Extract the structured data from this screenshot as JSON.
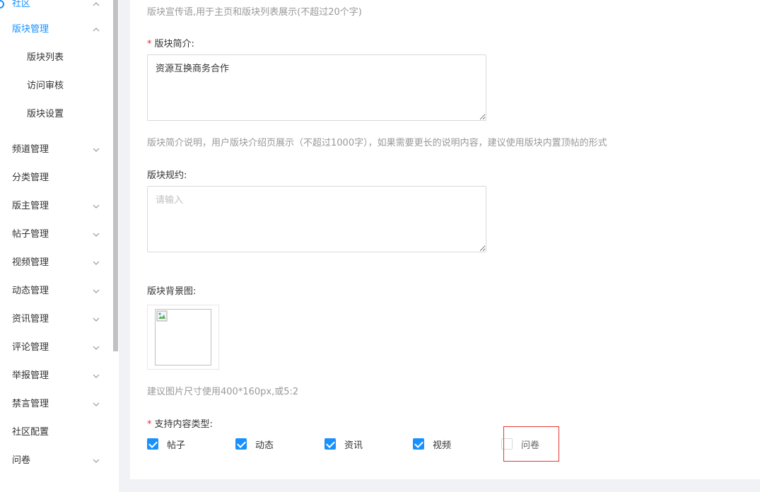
{
  "sidebar": {
    "community": "社区",
    "section_board": "版块管理",
    "board_sub": [
      "版块列表",
      "访问审核",
      "版块设置"
    ],
    "items": [
      {
        "label": "频道管理",
        "chevron": "down"
      },
      {
        "label": "分类管理",
        "chevron": ""
      },
      {
        "label": "版主管理",
        "chevron": "down"
      },
      {
        "label": "帖子管理",
        "chevron": "down"
      },
      {
        "label": "视频管理",
        "chevron": "down"
      },
      {
        "label": "动态管理",
        "chevron": "down"
      },
      {
        "label": "资讯管理",
        "chevron": "down"
      },
      {
        "label": "评论管理",
        "chevron": "down"
      },
      {
        "label": "举报管理",
        "chevron": "down"
      },
      {
        "label": "禁言管理",
        "chevron": "down"
      },
      {
        "label": "社区配置",
        "chevron": ""
      },
      {
        "label": "问卷",
        "chevron": "down"
      }
    ]
  },
  "form": {
    "slogan_hint": "版块宣传语,用于主页和版块列表展示(不超过20个字)",
    "intro_label": "版块简介:",
    "intro_value": "资源互换商务合作",
    "intro_hint": "版块简介说明，用户版块介绍页展示（不超过1000字），如果需要更长的说明内容，建议使用版块内置顶帖的形式",
    "rules_label": "版块规约:",
    "rules_placeholder": "请输入",
    "bg_label": "版块背景图:",
    "bg_hint": "建议图片尺寸使用400*160px,或5:2",
    "types_label": "支持内容类型:",
    "types": [
      {
        "label": "帖子",
        "checked": true
      },
      {
        "label": "动态",
        "checked": true
      },
      {
        "label": "资讯",
        "checked": true
      },
      {
        "label": "视频",
        "checked": true
      },
      {
        "label": "问卷",
        "checked": false
      }
    ]
  },
  "colors": {
    "accent": "#1890ff",
    "required": "#f5222d",
    "highlight": "#e53935"
  }
}
